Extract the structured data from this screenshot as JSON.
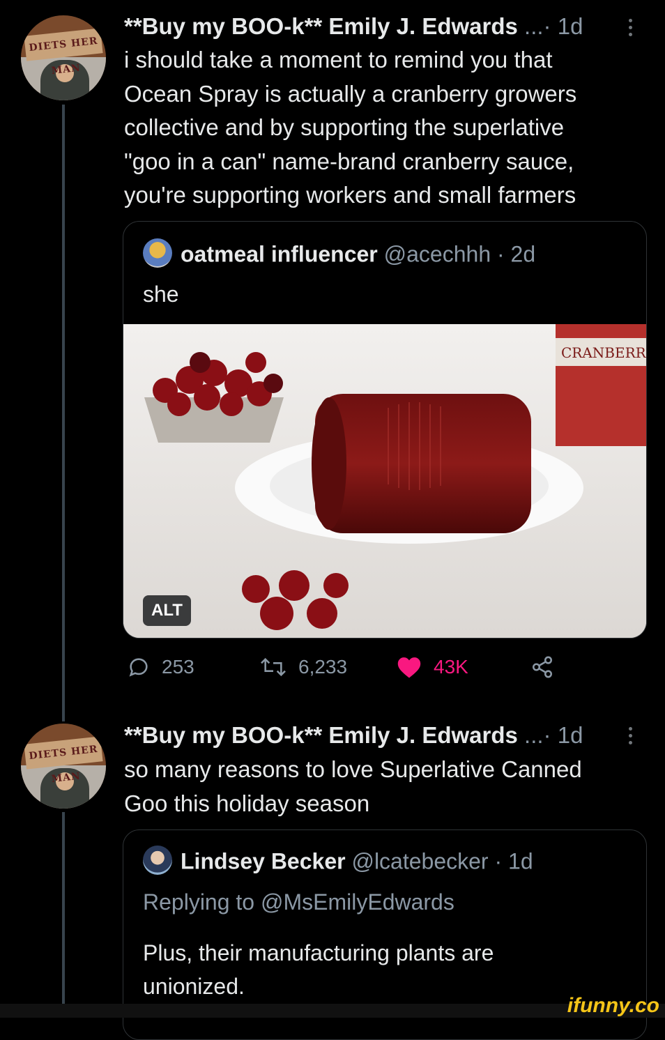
{
  "tweet1": {
    "author": "**Buy my BOO-k** Emily J. Edwards",
    "meta": "...· 1d",
    "text_lines": [
      "i should take a moment to remind you that",
      "Ocean Spray is actually a cranberry growers",
      "collective and by supporting the superlative",
      "\"goo in a can\" name-brand cranberry sauce,",
      "you're supporting workers and small farmers"
    ],
    "quote": {
      "name": "oatmeal influencer",
      "meta": "@acechhh · 2d",
      "text": "she",
      "alt_label": "ALT",
      "can_label": "CRANBERR"
    },
    "actions": {
      "replies": "253",
      "retweets": "6,233",
      "likes": "43K"
    }
  },
  "tweet2": {
    "author": "**Buy my BOO-k** Emily J. Edwards",
    "meta": "...· 1d",
    "text_lines": [
      "so many reasons to love Superlative Canned",
      "Goo this holiday season"
    ],
    "quote": {
      "name": "Lindsey Becker",
      "meta": "@lcatebecker · 1d",
      "replying": "Replying to @MsEmilyEdwards",
      "text_lines": [
        "Plus, their manufacturing plants are",
        "unionized."
      ]
    }
  },
  "avatar_sign": "DIETS HER MAN",
  "watermark": "ifunny.co",
  "colors": {
    "like": "#f91880",
    "muted": "#8b98a5",
    "border": "#2f3336"
  }
}
